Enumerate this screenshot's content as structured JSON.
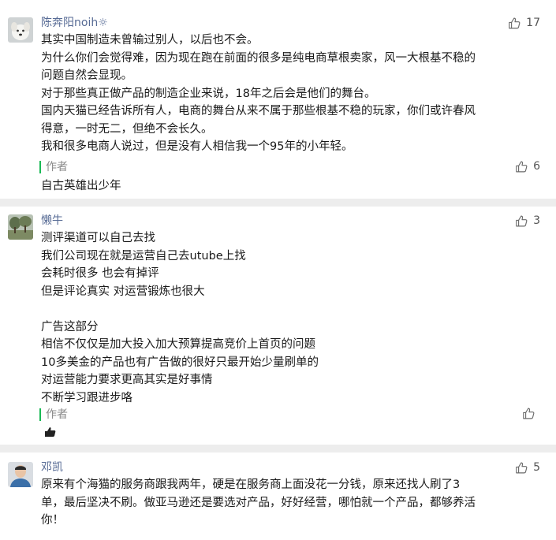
{
  "comments": [
    {
      "nickname": "陈奔阳noih☼",
      "avatar_icon": "white-dog-avatar",
      "likes": "17",
      "lines": [
        "其实中国制造未曾输过别人，以后也不会。",
        "为什么你们会觉得难，因为现在跑在前面的很多是纯电商草根卖家，风一大根基不稳的",
        "问题自然会显现。",
        "对于那些真正做产品的制造企业来说，18年之后会是他们的舞台。",
        "国内天猫已经告诉所有人，电商的舞台从来不属于那些根基不稳的玩家，你们或许春风",
        "得意，一时无二，但绝不会长久。",
        "我和很多电商人说过，但是没有人相信我一个95年的小年轻。"
      ],
      "reply": {
        "author": "作者",
        "likes": "6",
        "text": "自古英雄出少年"
      }
    },
    {
      "nickname": "懒牛",
      "avatar_icon": "tree-landscape-avatar",
      "likes": "3",
      "lines": [
        "测评渠道可以自己去找",
        "我们公司现在就是运营自己去utube上找",
        "会耗时很多 也会有掉评",
        "但是评论真实 对运营锻炼也很大",
        "",
        "广告这部分",
        "相信不仅仅是加大投入加大预算提高竞价上首页的问题",
        "10多美金的产品也有广告做的很好只最开始少量刷单的",
        "对运营能力要求更高其实是好事情",
        "不断学习跟进步咯"
      ],
      "reply": {
        "author": "作者",
        "likes": "",
        "text": ""
      }
    },
    {
      "nickname": "邓凯",
      "avatar_icon": "person-avatar",
      "likes": "5",
      "lines": [
        "原来有个海猫的服务商跟我两年，硬是在服务商上面没花一分钱，原来还找人刷了3",
        "单，最后坚决不刷。做亚马逊还是要选对产品，好好经营，哪怕就一个产品，都够养活",
        "你！"
      ]
    }
  ],
  "colors": {
    "nickname": "#576b95",
    "reply_bar": "#19b955",
    "separator": "#ededed"
  }
}
